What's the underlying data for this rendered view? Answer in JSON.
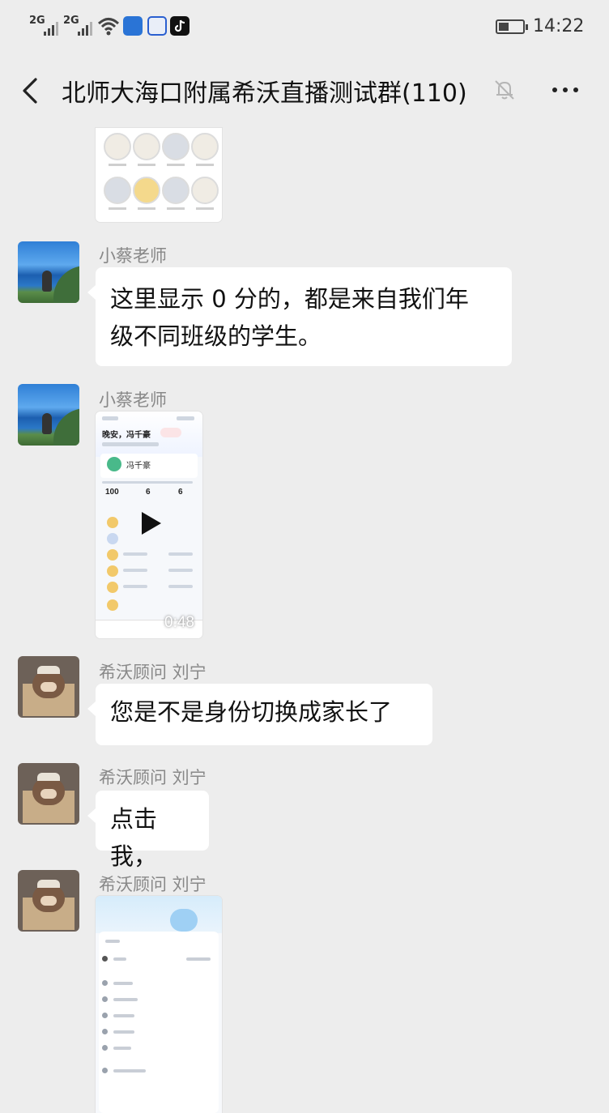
{
  "status_bar": {
    "network1": "2G",
    "network2": "2G",
    "time": "14:22"
  },
  "nav": {
    "title": "北师大海口附属希沃直播测试群(110)",
    "icons": [
      "back-icon",
      "mute-bell-icon",
      "more-icon"
    ]
  },
  "messages": [
    {
      "type": "image",
      "sender": "",
      "desc": ""
    },
    {
      "type": "text",
      "sender": "小蔡老师",
      "text_line1": "这里显示 0 分的，都是来自我们年",
      "text_line2": "级不同班级的学生。"
    },
    {
      "type": "video",
      "sender": "小蔡老师",
      "duration": "0:48",
      "thumb": {
        "greeting": "晚安，冯千豪",
        "name": "冯千豪",
        "stats": [
          "100",
          "6",
          "6"
        ]
      }
    },
    {
      "type": "text",
      "sender": "希沃顾问 刘宁",
      "text": "您是不是身份切换成家长了"
    },
    {
      "type": "text",
      "sender": "希沃顾问 刘宁",
      "text": "点击我，"
    },
    {
      "type": "image",
      "sender": "希沃顾问 刘宁"
    }
  ]
}
